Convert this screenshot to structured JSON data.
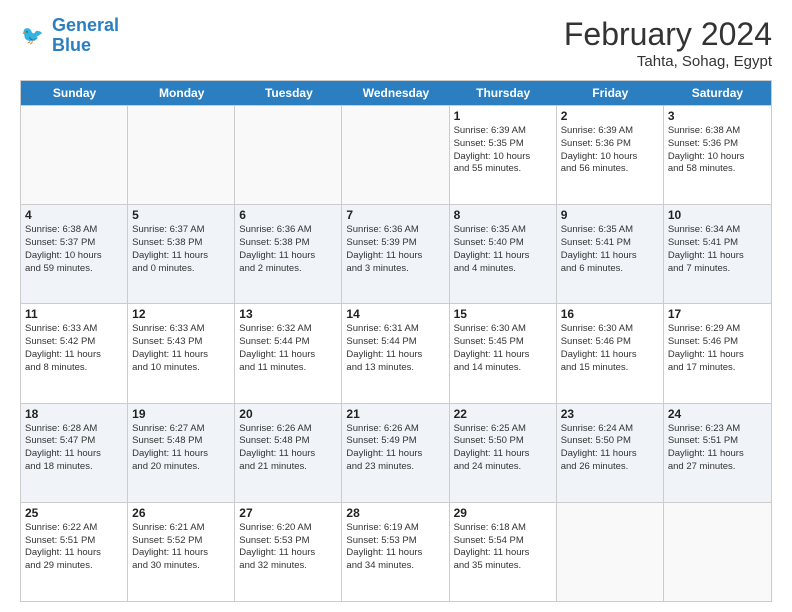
{
  "header": {
    "logo_line1": "General",
    "logo_line2": "Blue",
    "month_year": "February 2024",
    "location": "Tahta, Sohag, Egypt"
  },
  "days_of_week": [
    "Sunday",
    "Monday",
    "Tuesday",
    "Wednesday",
    "Thursday",
    "Friday",
    "Saturday"
  ],
  "rows": [
    [
      {
        "day": "",
        "lines": []
      },
      {
        "day": "",
        "lines": []
      },
      {
        "day": "",
        "lines": []
      },
      {
        "day": "",
        "lines": []
      },
      {
        "day": "1",
        "lines": [
          "Sunrise: 6:39 AM",
          "Sunset: 5:35 PM",
          "Daylight: 10 hours",
          "and 55 minutes."
        ]
      },
      {
        "day": "2",
        "lines": [
          "Sunrise: 6:39 AM",
          "Sunset: 5:36 PM",
          "Daylight: 10 hours",
          "and 56 minutes."
        ]
      },
      {
        "day": "3",
        "lines": [
          "Sunrise: 6:38 AM",
          "Sunset: 5:36 PM",
          "Daylight: 10 hours",
          "and 58 minutes."
        ]
      }
    ],
    [
      {
        "day": "4",
        "lines": [
          "Sunrise: 6:38 AM",
          "Sunset: 5:37 PM",
          "Daylight: 10 hours",
          "and 59 minutes."
        ]
      },
      {
        "day": "5",
        "lines": [
          "Sunrise: 6:37 AM",
          "Sunset: 5:38 PM",
          "Daylight: 11 hours",
          "and 0 minutes."
        ]
      },
      {
        "day": "6",
        "lines": [
          "Sunrise: 6:36 AM",
          "Sunset: 5:38 PM",
          "Daylight: 11 hours",
          "and 2 minutes."
        ]
      },
      {
        "day": "7",
        "lines": [
          "Sunrise: 6:36 AM",
          "Sunset: 5:39 PM",
          "Daylight: 11 hours",
          "and 3 minutes."
        ]
      },
      {
        "day": "8",
        "lines": [
          "Sunrise: 6:35 AM",
          "Sunset: 5:40 PM",
          "Daylight: 11 hours",
          "and 4 minutes."
        ]
      },
      {
        "day": "9",
        "lines": [
          "Sunrise: 6:35 AM",
          "Sunset: 5:41 PM",
          "Daylight: 11 hours",
          "and 6 minutes."
        ]
      },
      {
        "day": "10",
        "lines": [
          "Sunrise: 6:34 AM",
          "Sunset: 5:41 PM",
          "Daylight: 11 hours",
          "and 7 minutes."
        ]
      }
    ],
    [
      {
        "day": "11",
        "lines": [
          "Sunrise: 6:33 AM",
          "Sunset: 5:42 PM",
          "Daylight: 11 hours",
          "and 8 minutes."
        ]
      },
      {
        "day": "12",
        "lines": [
          "Sunrise: 6:33 AM",
          "Sunset: 5:43 PM",
          "Daylight: 11 hours",
          "and 10 minutes."
        ]
      },
      {
        "day": "13",
        "lines": [
          "Sunrise: 6:32 AM",
          "Sunset: 5:44 PM",
          "Daylight: 11 hours",
          "and 11 minutes."
        ]
      },
      {
        "day": "14",
        "lines": [
          "Sunrise: 6:31 AM",
          "Sunset: 5:44 PM",
          "Daylight: 11 hours",
          "and 13 minutes."
        ]
      },
      {
        "day": "15",
        "lines": [
          "Sunrise: 6:30 AM",
          "Sunset: 5:45 PM",
          "Daylight: 11 hours",
          "and 14 minutes."
        ]
      },
      {
        "day": "16",
        "lines": [
          "Sunrise: 6:30 AM",
          "Sunset: 5:46 PM",
          "Daylight: 11 hours",
          "and 15 minutes."
        ]
      },
      {
        "day": "17",
        "lines": [
          "Sunrise: 6:29 AM",
          "Sunset: 5:46 PM",
          "Daylight: 11 hours",
          "and 17 minutes."
        ]
      }
    ],
    [
      {
        "day": "18",
        "lines": [
          "Sunrise: 6:28 AM",
          "Sunset: 5:47 PM",
          "Daylight: 11 hours",
          "and 18 minutes."
        ]
      },
      {
        "day": "19",
        "lines": [
          "Sunrise: 6:27 AM",
          "Sunset: 5:48 PM",
          "Daylight: 11 hours",
          "and 20 minutes."
        ]
      },
      {
        "day": "20",
        "lines": [
          "Sunrise: 6:26 AM",
          "Sunset: 5:48 PM",
          "Daylight: 11 hours",
          "and 21 minutes."
        ]
      },
      {
        "day": "21",
        "lines": [
          "Sunrise: 6:26 AM",
          "Sunset: 5:49 PM",
          "Daylight: 11 hours",
          "and 23 minutes."
        ]
      },
      {
        "day": "22",
        "lines": [
          "Sunrise: 6:25 AM",
          "Sunset: 5:50 PM",
          "Daylight: 11 hours",
          "and 24 minutes."
        ]
      },
      {
        "day": "23",
        "lines": [
          "Sunrise: 6:24 AM",
          "Sunset: 5:50 PM",
          "Daylight: 11 hours",
          "and 26 minutes."
        ]
      },
      {
        "day": "24",
        "lines": [
          "Sunrise: 6:23 AM",
          "Sunset: 5:51 PM",
          "Daylight: 11 hours",
          "and 27 minutes."
        ]
      }
    ],
    [
      {
        "day": "25",
        "lines": [
          "Sunrise: 6:22 AM",
          "Sunset: 5:51 PM",
          "Daylight: 11 hours",
          "and 29 minutes."
        ]
      },
      {
        "day": "26",
        "lines": [
          "Sunrise: 6:21 AM",
          "Sunset: 5:52 PM",
          "Daylight: 11 hours",
          "and 30 minutes."
        ]
      },
      {
        "day": "27",
        "lines": [
          "Sunrise: 6:20 AM",
          "Sunset: 5:53 PM",
          "Daylight: 11 hours",
          "and 32 minutes."
        ]
      },
      {
        "day": "28",
        "lines": [
          "Sunrise: 6:19 AM",
          "Sunset: 5:53 PM",
          "Daylight: 11 hours",
          "and 34 minutes."
        ]
      },
      {
        "day": "29",
        "lines": [
          "Sunrise: 6:18 AM",
          "Sunset: 5:54 PM",
          "Daylight: 11 hours",
          "and 35 minutes."
        ]
      },
      {
        "day": "",
        "lines": []
      },
      {
        "day": "",
        "lines": []
      }
    ]
  ]
}
